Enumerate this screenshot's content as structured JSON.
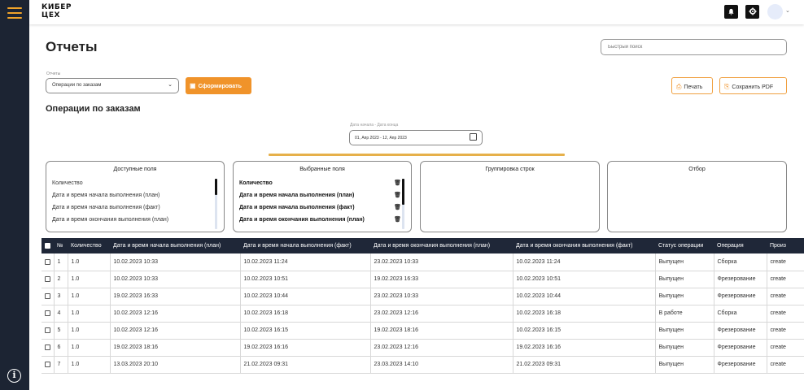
{
  "app": {
    "logo_line1": "КИБЕР",
    "logo_line2": "ЦЕХ"
  },
  "topbar": {
    "icons": [
      "bell-icon",
      "gear-icon"
    ],
    "avatar_caret": "⌄"
  },
  "page": {
    "title": "Отчеты",
    "search_placeholder": "Быстрый поиск"
  },
  "report": {
    "label": "Отчеты",
    "selected": "Операции по заказам",
    "form_button": "Сформировать",
    "print_button": "Печать",
    "pdf_button": "Сохранить PDF"
  },
  "section": {
    "title": "Операции по заказам",
    "date_label": "Дата начала - Дата конца",
    "date_value": "01, Апр 2023 - 12, Апр 2023"
  },
  "panels": {
    "available": {
      "title": "Доступные поля",
      "items": [
        "Количество",
        "Дата и время начала выполнения (план)",
        "Дата и время начала выполнения (факт)",
        "Дата и время окончания выполнения (план)"
      ]
    },
    "selected": {
      "title": "Выбранные поля",
      "items": [
        "Количество",
        "Дата и время начала выполнения (план)",
        "Дата и время начала выполнения (факт)",
        "Дата и время окончания выполнения (план)"
      ]
    },
    "grouping": {
      "title": "Группировка строк"
    },
    "filter": {
      "title": "Отбор"
    }
  },
  "table": {
    "headers": [
      "№",
      "Количество",
      "Дата и время начала выполнения (план)",
      "Дата и время начала выполнения (факт)",
      "Дата и время окончания выполнения (план)",
      "Дата и время окончания выполнения (факт)",
      "Статус операции",
      "Операция",
      "Произ"
    ],
    "rows": [
      [
        "1",
        "1.0",
        "10.02.2023 10:33",
        "10.02.2023 11:24",
        "23.02.2023 10:33",
        "10.02.2023 11:24",
        "Выпущен",
        "Сборка",
        "create"
      ],
      [
        "2",
        "1.0",
        "10.02.2023 10:33",
        "10.02.2023 10:51",
        "19.02.2023 16:33",
        "10.02.2023 10:51",
        "Выпущен",
        "Фрезерование",
        "create"
      ],
      [
        "3",
        "1.0",
        "19.02.2023 16:33",
        "10.02.2023 10:44",
        "23.02.2023 10:33",
        "10.02.2023 10:44",
        "Выпущен",
        "Фрезерование",
        "create"
      ],
      [
        "4",
        "1.0",
        "10.02.2023 12:16",
        "10.02.2023 16:18",
        "23.02.2023 12:16",
        "10.02.2023 16:18",
        "В работе",
        "Сборка",
        "create"
      ],
      [
        "5",
        "1.0",
        "10.02.2023 12:16",
        "10.02.2023 16:15",
        "19.02.2023 18:16",
        "10.02.2023 16:15",
        "Выпущен",
        "Фрезерование",
        "create"
      ],
      [
        "6",
        "1.0",
        "19.02.2023 18:16",
        "19.02.2023 16:16",
        "23.02.2023 12:16",
        "19.02.2023 16:16",
        "Выпущен",
        "Фрезерование",
        "create"
      ],
      [
        "7",
        "1.0",
        "13.03.2023 20:10",
        "21.02.2023 09:31",
        "23.03.2023 14:10",
        "21.02.2023 09:31",
        "Выпущен",
        "Фрезерование",
        "create"
      ]
    ]
  },
  "colors": {
    "accent": "#f0932a",
    "rail": "#1c2433",
    "table_header": "#1f2738",
    "divider": "#e6b04a"
  }
}
